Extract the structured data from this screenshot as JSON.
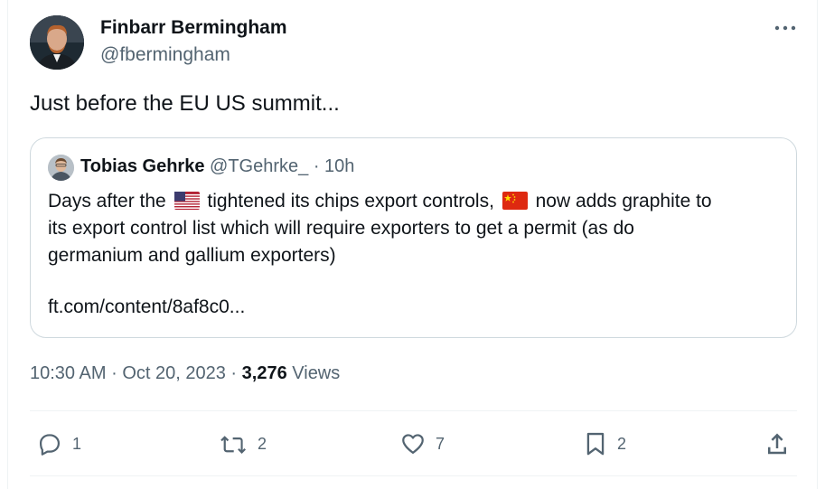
{
  "author": {
    "name": "Finbarr Bermingham",
    "handle": "@fbermingham"
  },
  "tweet": {
    "text": "Just before the EU US summit..."
  },
  "quoted_tweet": {
    "name": "Tobias Gehrke",
    "handle": "@TGehrke_",
    "separator": "·",
    "time": "10h",
    "line1_a": "Days after the",
    "line1_b": "tightened its chips export controls,",
    "line1_c": "now adds graphite to",
    "line2": "its export control list which will require exporters to get a permit (as do",
    "line3": "germanium and gallium exporters)",
    "link": "ft.com/content/8af8c0...",
    "flags": [
      "us-flag-icon",
      "china-flag-icon"
    ]
  },
  "meta": {
    "time": "10:30 AM",
    "date": "Oct 20, 2023",
    "separator": "·",
    "views_count": "3,276",
    "views_label": "Views"
  },
  "actions": {
    "replies": "1",
    "reposts": "2",
    "likes": "7",
    "bookmarks": "2"
  },
  "colors": {
    "text_primary": "#0f1419",
    "text_secondary": "#536471",
    "border": "#cfd9de"
  }
}
